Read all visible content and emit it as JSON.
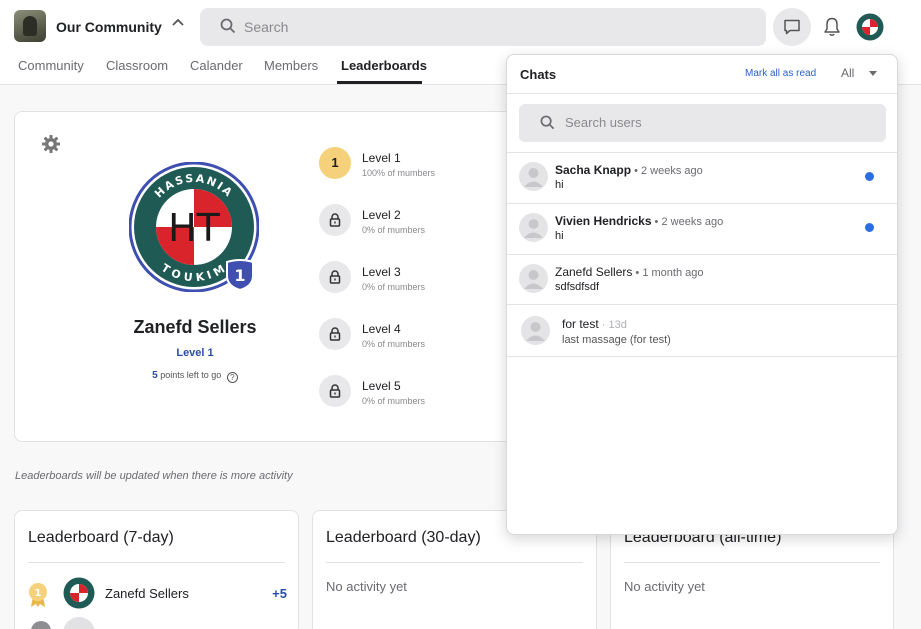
{
  "header": {
    "community_name": "Our Community",
    "search_placeholder": "Search"
  },
  "tabs": [
    {
      "label": "Community"
    },
    {
      "label": "Classroom"
    },
    {
      "label": "Calander"
    },
    {
      "label": "Members"
    },
    {
      "label": "Leaderboards",
      "active": true
    }
  ],
  "profile": {
    "name": "Zanefd Sellers",
    "level_label": "Level 1",
    "level_badge": "1",
    "points_left": "5",
    "points_suffix": "points left to go",
    "avatar_text": "HT",
    "avatar_ring_top": "HASSANIA",
    "avatar_ring_bottom": "TOUKIM"
  },
  "levels": [
    {
      "number": "1",
      "title": "Level 1",
      "sub": "100% of mumbers",
      "unlocked": true
    },
    {
      "title": "Level 2",
      "sub": "0% of mumbers",
      "unlocked": false
    },
    {
      "title": "Level 3",
      "sub": "0% of mumbers",
      "unlocked": false
    },
    {
      "title": "Level 4",
      "sub": "0% of mumbers",
      "unlocked": false
    },
    {
      "title": "Level 5",
      "sub": "0% of mumbers",
      "unlocked": false
    }
  ],
  "update_note": "Leaderboards will be updated when there is more activity",
  "leaderboards": [
    {
      "title": "Leaderboard (7-day)",
      "rows": [
        {
          "rank": "1",
          "name": "Zanefd Sellers",
          "points": "+5"
        }
      ]
    },
    {
      "title": "Leaderboard (30-day)",
      "empty": "No activity yet"
    },
    {
      "title": "Leaderboard (all-time)",
      "empty": "No activity yet"
    }
  ],
  "chats": {
    "title": "Chats",
    "mark_all_read": "Mark all as read",
    "filter": "All",
    "search_placeholder": "Search users",
    "items": [
      {
        "name": "Sacha Knapp",
        "time": " • 2 weeks ago",
        "message": "hi",
        "unread": true
      },
      {
        "name": "Vivien Hendricks",
        "time": " • 2 weeks ago",
        "message": "hi",
        "unread": true
      },
      {
        "name": "Zanefd Sellers",
        "time": " • 1 month ago",
        "message": "sdfsdfsdf",
        "unread": false
      },
      {
        "name": "for test",
        "time": " · 13d",
        "message": "last massage (for test)",
        "unread": false
      }
    ]
  },
  "colors": {
    "accent_blue": "#2a4ea6",
    "unread_dot": "#2a6ee0",
    "gold": "#f4d17a",
    "logo_red": "#d9242b",
    "logo_teal": "#1f5a55"
  }
}
